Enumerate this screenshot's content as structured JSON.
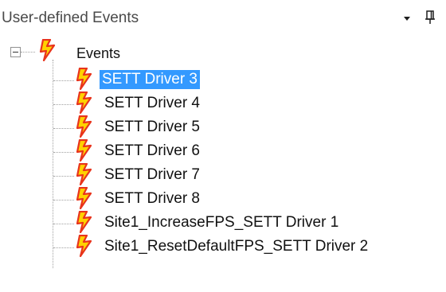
{
  "panel": {
    "title": "User-defined Events",
    "dropdown_icon": "triangle-down-icon",
    "pin_icon": "pin-icon"
  },
  "tree": {
    "root": {
      "label": "Events",
      "icon": "event-lightning-icon",
      "expanded": true
    },
    "items": [
      {
        "label": "SETT Driver 3",
        "selected": true,
        "icon": "event-lightning-icon"
      },
      {
        "label": "SETT Driver 4",
        "selected": false,
        "icon": "event-lightning-icon"
      },
      {
        "label": "SETT Driver 5",
        "selected": false,
        "icon": "event-lightning-icon"
      },
      {
        "label": "SETT Driver 6",
        "selected": false,
        "icon": "event-lightning-icon"
      },
      {
        "label": "SETT Driver 7",
        "selected": false,
        "icon": "event-lightning-icon"
      },
      {
        "label": "SETT Driver 8",
        "selected": false,
        "icon": "event-lightning-icon"
      },
      {
        "label": "Site1_IncreaseFPS_SETT Driver 1",
        "selected": false,
        "icon": "event-lightning-icon"
      },
      {
        "label": "Site1_ResetDefaultFPS_SETT Driver 2",
        "selected": false,
        "icon": "event-lightning-icon"
      }
    ]
  },
  "colors": {
    "selection": "#3399ff",
    "header_text": "#4a4a4a",
    "icon_red": "#e8341c",
    "icon_yellow": "#ffd200"
  }
}
